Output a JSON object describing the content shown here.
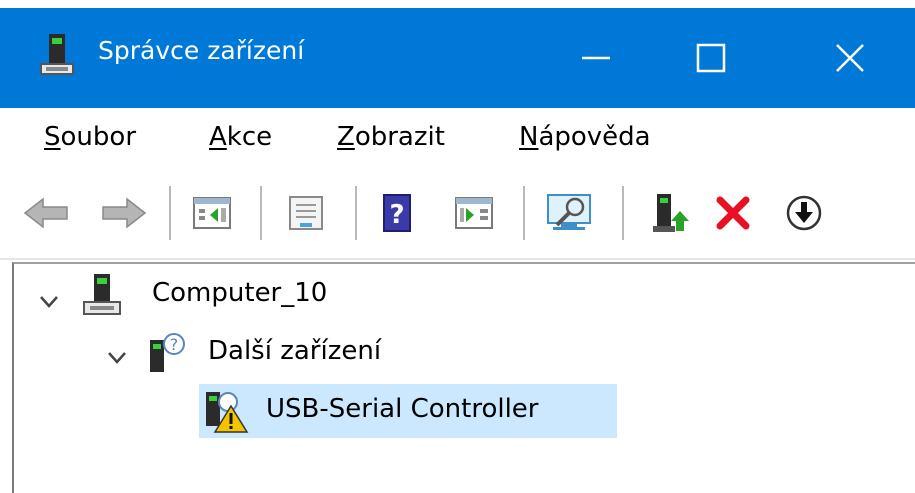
{
  "window": {
    "title": "Správce zařízení",
    "buttons": {
      "minimize": "minimize",
      "maximize": "maximize",
      "close": "close"
    },
    "accent": "#0078d7"
  },
  "menu": {
    "items": [
      {
        "accel": "S",
        "rest": "oubor"
      },
      {
        "accel": "A",
        "rest": "kce"
      },
      {
        "accel": "Z",
        "rest": "obrazit"
      },
      {
        "accel": "N",
        "rest": "ápověda"
      }
    ]
  },
  "toolbar": {
    "icons": [
      "back-icon",
      "forward-icon",
      "show-hide-console-tree-icon",
      "properties-icon",
      "help-icon",
      "action-pane-icon",
      "scan-for-hardware-changes-icon",
      "update-driver-icon",
      "uninstall-icon",
      "disable-device-icon"
    ]
  },
  "tree": {
    "root": {
      "label": "Computer_10",
      "expanded": true
    },
    "category": {
      "label": "Další zařízení",
      "expanded": true
    },
    "device": {
      "label": "USB-Serial Controller",
      "selected": true,
      "status": "warning"
    }
  },
  "colors": {
    "selection": "#cce8ff",
    "warning": "#f5c400",
    "uninstall": "#e81123"
  }
}
